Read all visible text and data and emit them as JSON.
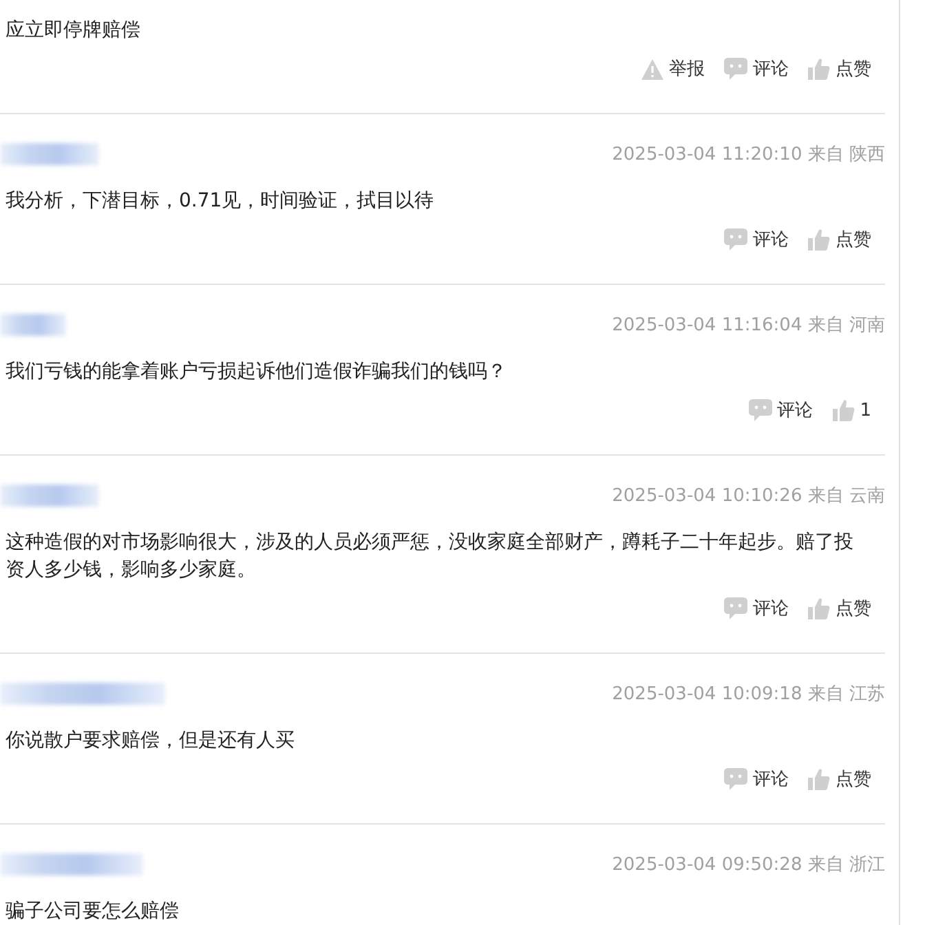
{
  "comments": [
    {
      "text": "应立即停牌赔偿",
      "actions": [
        {
          "kind": "report",
          "label": "举报"
        },
        {
          "kind": "comment",
          "label": "评论"
        },
        {
          "kind": "like",
          "label": "点赞"
        }
      ]
    },
    {
      "header": {
        "time": "2025-03-04 11:20:10",
        "origin": "来自 陕西"
      },
      "text": "我分析，下潜目标，0.71见，时间验证，拭目以待",
      "actions": [
        {
          "kind": "comment",
          "label": "评论"
        },
        {
          "kind": "like",
          "label": "点赞"
        }
      ]
    },
    {
      "header": {
        "time": "2025-03-04 11:16:04",
        "origin": "来自 河南"
      },
      "text": "我们亏钱的能拿着账户亏损起诉他们造假诈骗我们的钱吗？",
      "actions": [
        {
          "kind": "comment",
          "label": "评论"
        },
        {
          "kind": "like",
          "label": "1"
        }
      ]
    },
    {
      "header": {
        "time": "2025-03-04 10:10:26",
        "origin": "来自 云南"
      },
      "text": "这种造假的对市场影响很大，涉及的人员必须严惩，没收家庭全部财产，蹲耗子二十年起步。赔了投资人多少钱，影响多少家庭。",
      "actions": [
        {
          "kind": "comment",
          "label": "评论"
        },
        {
          "kind": "like",
          "label": "点赞"
        }
      ]
    },
    {
      "header": {
        "time": "2025-03-04 10:09:18",
        "origin": "来自 江苏"
      },
      "text": "你说散户要求赔偿，但是还有人买",
      "actions": [
        {
          "kind": "comment",
          "label": "评论"
        },
        {
          "kind": "like",
          "label": "点赞"
        }
      ]
    },
    {
      "header": {
        "time": "2025-03-04 09:50:28",
        "origin": "来自 浙江"
      },
      "text": "骗子公司要怎么赔偿"
    }
  ]
}
